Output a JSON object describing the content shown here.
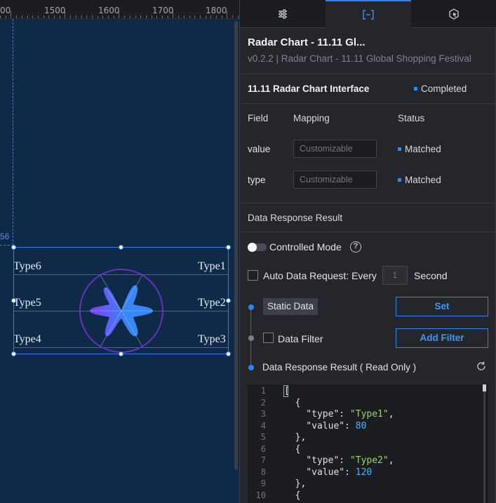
{
  "ruler": {
    "labels": [
      "00",
      "1500",
      "1600",
      "1700",
      "1800"
    ]
  },
  "canvas": {
    "guide_label": "56",
    "chart": {
      "types": [
        "Type1",
        "Type2",
        "Type3",
        "Type4",
        "Type5",
        "Type6"
      ],
      "gradient_colors": [
        "#3a8cff",
        "#8a3cff"
      ]
    }
  },
  "tabs": [
    {
      "icon": "sliders-icon"
    },
    {
      "icon": "data-bracket-icon"
    },
    {
      "icon": "interaction-cursor-icon"
    }
  ],
  "component": {
    "title": "Radar Chart - 11.11 Gl...",
    "subtitle": "v0.2.2 | Radar Chart - 11.11 Global Shopping Festival"
  },
  "interface": {
    "title": "11.11 Radar Chart Interface",
    "status": "Completed"
  },
  "mapping": {
    "headers": {
      "field": "Field",
      "mapping": "Mapping",
      "status": "Status"
    },
    "rows": [
      {
        "field": "value",
        "placeholder": "Customizable",
        "status": "Matched"
      },
      {
        "field": "type",
        "placeholder": "Customizable",
        "status": "Matched"
      }
    ]
  },
  "response": {
    "title": "Data Response Result",
    "controlled_mode_label": "Controlled Mode",
    "help_glyph": "?",
    "auto_request_label": "Auto Data Request: Every",
    "auto_interval": "1",
    "second_label": "Second",
    "static_data_label": "Static Data",
    "set_button": "Set",
    "data_filter_label": "Data Filter",
    "add_filter_button": "Add Filter",
    "readonly_label": "Data Response Result ( Read Only )"
  },
  "code": {
    "line_numbers": [
      "1",
      "2",
      "3",
      "4",
      "5",
      "6",
      "7",
      "8",
      "9",
      "10"
    ],
    "lines": [
      "[",
      "  {",
      "    \"type\": \"Type1\",",
      "    \"value\": 80",
      "  },",
      "  {",
      "    \"type\": \"Type2\",",
      "    \"value\": 120",
      "  },",
      "  {"
    ]
  }
}
